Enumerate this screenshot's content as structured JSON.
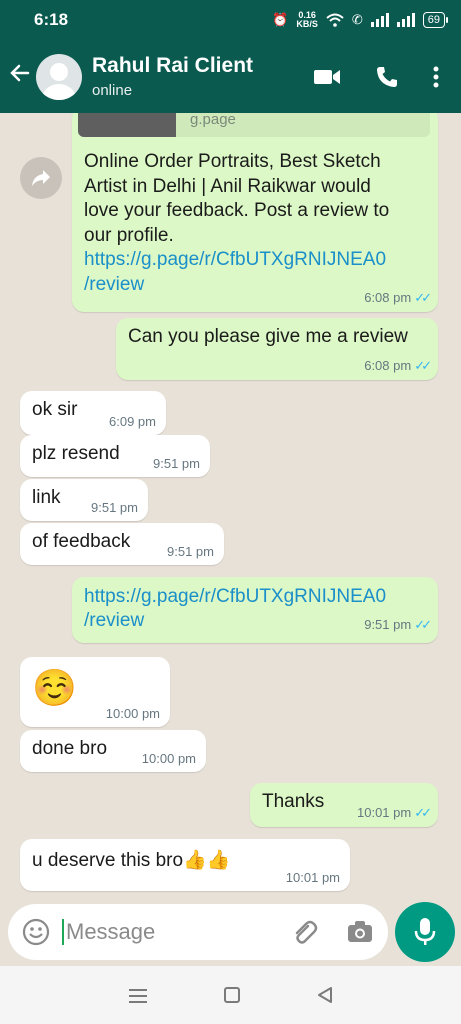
{
  "status_bar": {
    "time": "6:18",
    "net_speed_value": "0.16",
    "net_speed_unit": "KB/S",
    "battery": "69"
  },
  "header": {
    "contact_name": "Rahul Rai Client",
    "contact_status": "online"
  },
  "link_preview": {
    "domain": "g.page"
  },
  "messages": [
    {
      "dir": "out",
      "text_lines": [
        "Online Order Portraits, Best Sketch",
        "Artist in Delhi | Anil Raikwar would",
        "love your feedback. Post a review to",
        "our profile."
      ],
      "link": [
        "https://g.page/r/CfbUTXgRNIJNEA0",
        "/review"
      ],
      "time": "6:08 pm"
    },
    {
      "dir": "out",
      "text": "Can you please give me a review",
      "time": "6:08 pm"
    },
    {
      "dir": "in",
      "text": "ok sir",
      "time": "6:09 pm"
    },
    {
      "dir": "in",
      "text": "plz resend",
      "time": "9:51 pm"
    },
    {
      "dir": "in",
      "text": "link",
      "time": "9:51 pm"
    },
    {
      "dir": "in",
      "text": "of feedback",
      "time": "9:51 pm"
    },
    {
      "dir": "out",
      "link": [
        "https://g.page/r/CfbUTXgRNIJNEA0",
        "/review"
      ],
      "time": "9:51 pm"
    },
    {
      "dir": "in",
      "emoji": "☺️",
      "time": "10:00 pm"
    },
    {
      "dir": "in",
      "text": "done bro",
      "time": "10:00 pm"
    },
    {
      "dir": "out",
      "text": "Thanks",
      "time": "10:01 pm"
    },
    {
      "dir": "in",
      "text": "u deserve this bro👍👍",
      "time": "10:01 pm"
    }
  ],
  "composer": {
    "placeholder": "Message"
  },
  "icons": {
    "back": "arrow-left-icon",
    "video": "video-call-icon",
    "call": "phone-icon",
    "menu": "more-vert-icon",
    "share": "forward-icon",
    "emoji": "emoji-icon",
    "attach": "paperclip-icon",
    "camera": "camera-icon",
    "mic": "mic-icon"
  },
  "colors": {
    "header": "#0a5a50",
    "outgoing_bubble": "#dcf8c6",
    "incoming_bubble": "#ffffff",
    "link": "#1a8fc9",
    "read_ticks": "#34b7f1",
    "mic_button": "#009a83"
  }
}
